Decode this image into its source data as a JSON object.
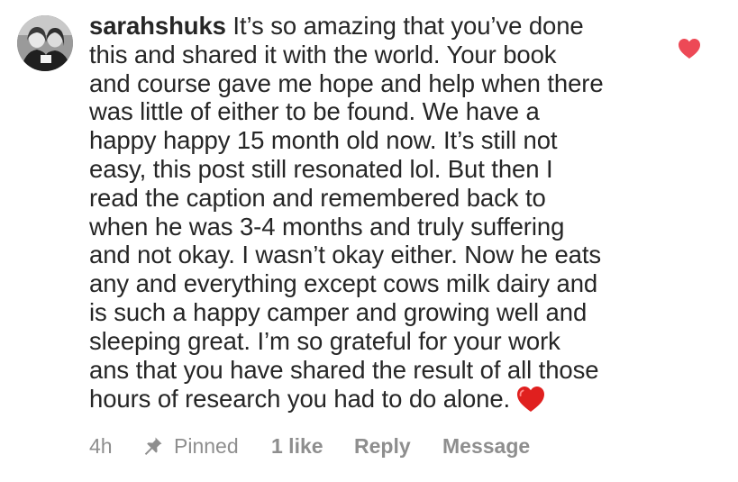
{
  "comment": {
    "username": "sarahshuks",
    "text": "It’s so amazing that you’ve done\nthis and shared it with the world. Your book\nand course gave me hope and help when there\nwas little of either to be found. We have a\nhappy happy 15 month old now. It’s still not\neasy, this post still resonated lol. But then I\nread the caption and remembered back to\nwhen he was 3-4 months and truly suffering\nand not okay. I wasn’t okay either. Now he eats\nany and everything except cows milk dairy and\nis such a happy camper and growing well and\nsleeping great. I’m so grateful for your work\nans that you have shared the result of all those\nhours of research you had to do alone.",
    "trailing_emoji": "red-heart-emoji",
    "like_icon": "heart-icon",
    "liked": true
  },
  "meta": {
    "time": "4h",
    "pin_icon": "pin-icon",
    "pinned_label": "Pinned",
    "likes_label": "1 like",
    "reply_label": "Reply",
    "message_label": "Message"
  },
  "colors": {
    "text": "#262626",
    "secondary": "#8e8e8e",
    "like_heart": "#ed4956",
    "emoji_heart": "#e0201f"
  }
}
